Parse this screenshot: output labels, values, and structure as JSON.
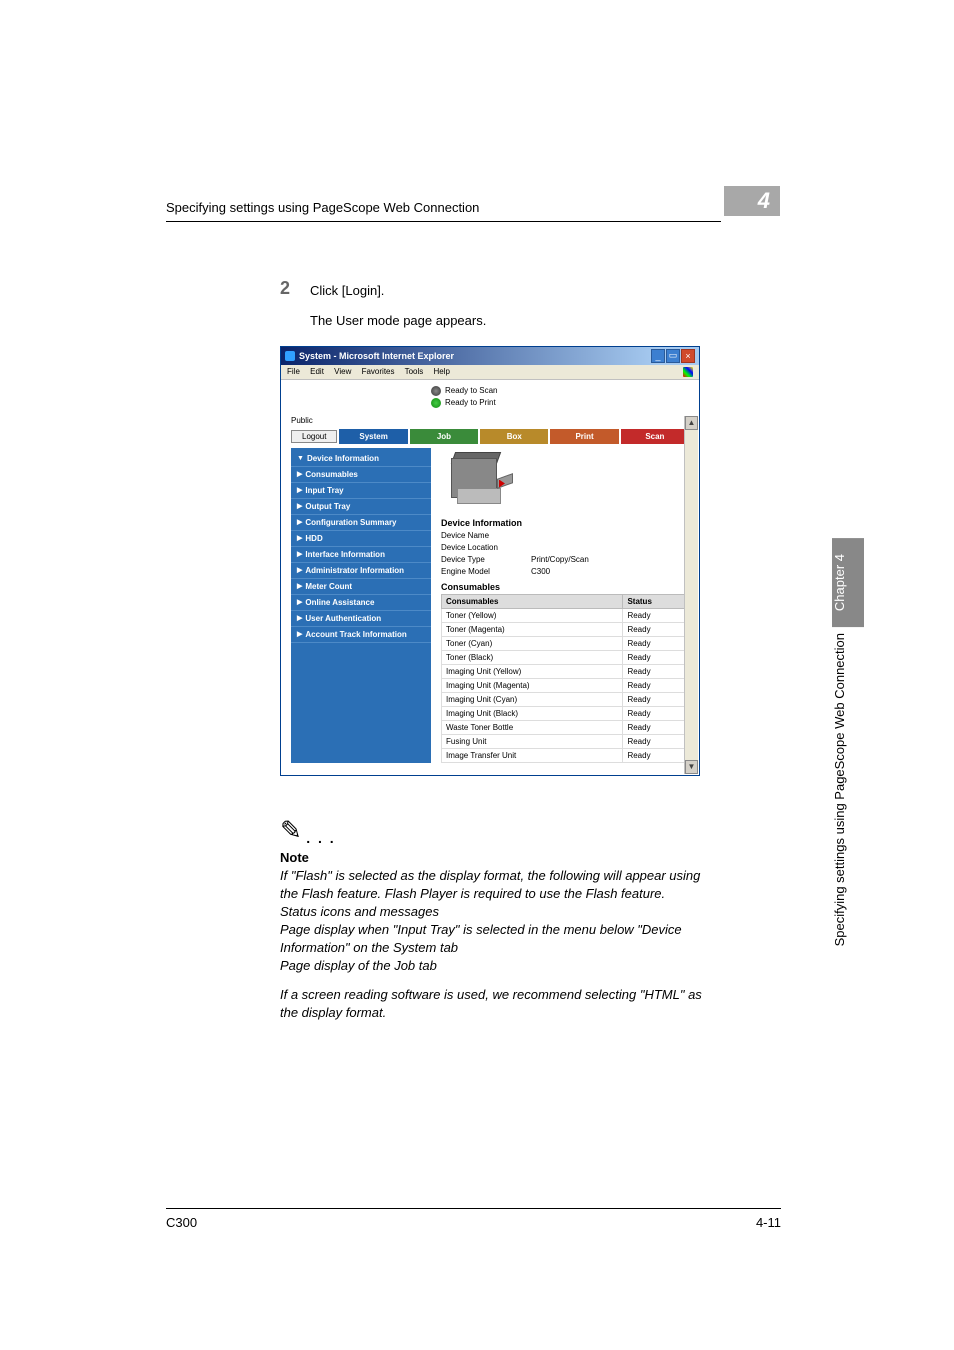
{
  "header": {
    "title": "Specifying settings using PageScope Web Connection",
    "chapter_number": "4"
  },
  "step": {
    "number": "2",
    "text": "Click [Login].",
    "sub": "The User mode page appears."
  },
  "screenshot": {
    "titlebar": {
      "title": "System - Microsoft Internet Explorer"
    },
    "menubar": {
      "file": "File",
      "edit": "Edit",
      "view": "View",
      "favorites": "Favorites",
      "tools": "Tools",
      "help": "Help"
    },
    "status": {
      "scan": "Ready to Scan",
      "print": "Ready to Print"
    },
    "public": "Public",
    "logout": "Logout",
    "tabs": {
      "system": "System",
      "job": "Job",
      "box": "Box",
      "print": "Print",
      "scan": "Scan"
    },
    "sidebar": [
      "Device Information",
      "Consumables",
      "Input Tray",
      "Output Tray",
      "Configuration Summary",
      "HDD",
      "Interface Information",
      "Administrator Information",
      "Meter Count",
      "Online Assistance",
      "User Authentication",
      "Account Track Information"
    ],
    "sidebar_arrows": [
      "▼",
      "▶",
      "▶",
      "▶",
      "▶",
      "▶",
      "▶",
      "▶",
      "▶",
      "▶",
      "▶",
      "▶"
    ],
    "device_info_hdr": "Device Information",
    "device_info": [
      {
        "k": "Device Name",
        "v": ""
      },
      {
        "k": "Device Location",
        "v": ""
      },
      {
        "k": "Device Type",
        "v": "Print/Copy/Scan"
      },
      {
        "k": "Engine Model",
        "v": "C300"
      }
    ],
    "consumables_hdr": "Consumables",
    "cons_th": {
      "name": "Consumables",
      "status": "Status"
    },
    "consumables": [
      {
        "name": "Toner (Yellow)",
        "status": "Ready"
      },
      {
        "name": "Toner (Magenta)",
        "status": "Ready"
      },
      {
        "name": "Toner (Cyan)",
        "status": "Ready"
      },
      {
        "name": "Toner (Black)",
        "status": "Ready"
      },
      {
        "name": "Imaging Unit (Yellow)",
        "status": "Ready"
      },
      {
        "name": "Imaging Unit (Magenta)",
        "status": "Ready"
      },
      {
        "name": "Imaging Unit (Cyan)",
        "status": "Ready"
      },
      {
        "name": "Imaging Unit (Black)",
        "status": "Ready"
      },
      {
        "name": "Waste Toner Bottle",
        "status": "Ready"
      },
      {
        "name": "Fusing Unit",
        "status": "Ready"
      },
      {
        "name": "Image Transfer Unit",
        "status": "Ready"
      }
    ]
  },
  "note": {
    "label": "Note",
    "para1": "If \"Flash\" is selected as the display format, the following will appear using the Flash feature. Flash Player is required to use the Flash feature.\nStatus icons and messages\nPage display when \"Input Tray\" is selected in the menu below \"Device Information\" on the System tab\nPage display of the Job tab",
    "para2": "If a screen reading software is used, we recommend selecting \"HTML\" as the display format."
  },
  "side": {
    "chapter": "Chapter 4",
    "text": "Specifying settings using PageScope Web Connection"
  },
  "footer": {
    "left": "C300",
    "right": "4-11"
  }
}
